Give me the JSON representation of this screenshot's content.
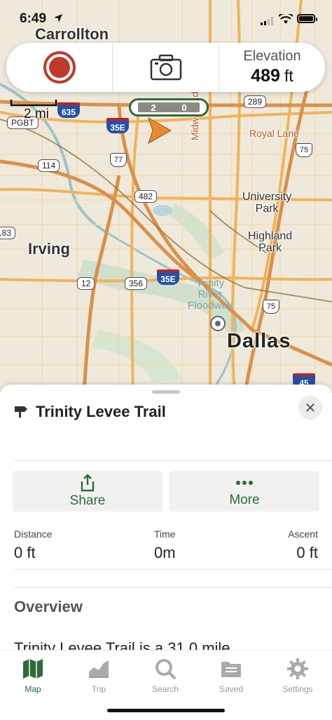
{
  "status_bar": {
    "time": "6:49"
  },
  "map": {
    "labels": {
      "carrollton": "Carrollton",
      "irving": "Irving",
      "dallas": "Dallas",
      "university_park": "University\nPark",
      "highland_park": "Highland\nPark",
      "royal_lane": "Royal Lane",
      "midway_road": "Midway Rd",
      "trinity_river": "Trinity\nRiver\nFloodway",
      "pgbt": "PGBT"
    },
    "shields": {
      "i635": "635",
      "i35e_top": "35E",
      "i35e_mid": "35E",
      "i45": "45",
      "us77": "77",
      "us75_top": "75",
      "us75_mid": "75",
      "r114": "114",
      "r482": "482",
      "r289": "289",
      "r12": "12",
      "r356": "356",
      "r183": "183"
    },
    "scale_label": "2 mi",
    "counter_digits": [
      "2",
      "0"
    ]
  },
  "toolbar": {
    "elevation_label": "Elevation",
    "elevation_value": "489",
    "elevation_unit": "ft"
  },
  "sheet": {
    "title": "Trinity Levee Trail",
    "actions": {
      "share": "Share",
      "more": "More"
    },
    "stats": [
      {
        "label": "Distance",
        "value": "0 ft"
      },
      {
        "label": "Time",
        "value": "0m"
      },
      {
        "label": "Ascent",
        "value": "0 ft"
      }
    ],
    "overview_heading": "Overview",
    "description": "Trinity Levee Trail is a 31.0 mile"
  },
  "tabs": [
    {
      "label": "Map",
      "icon": "map-icon",
      "active": true
    },
    {
      "label": "Trip",
      "icon": "trip-chart-icon",
      "active": false
    },
    {
      "label": "Search",
      "icon": "search-icon",
      "active": false
    },
    {
      "label": "Saved",
      "icon": "saved-folder-icon",
      "active": false
    },
    {
      "label": "Settings",
      "icon": "gear-icon",
      "active": false
    }
  ],
  "colors": {
    "brand_green": "#2e6b3a",
    "record_red": "#c0392b",
    "road_orange": "#f0b45a"
  }
}
